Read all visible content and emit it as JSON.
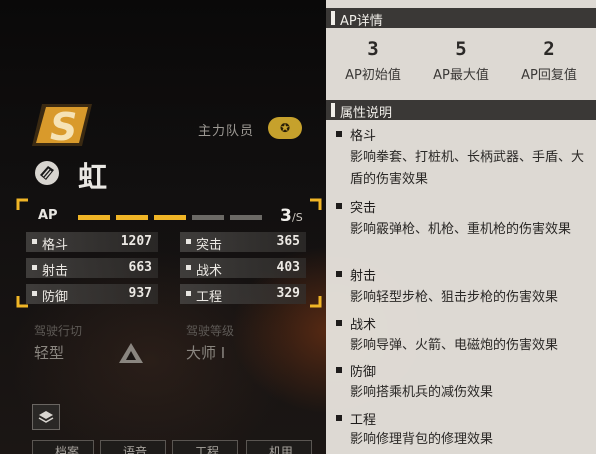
{
  "character": {
    "rank": "S",
    "member_label": "主力队员",
    "member_badge_icon": "squad-badge-icon",
    "name": "虹"
  },
  "ap": {
    "label": "AP",
    "current": "3",
    "unit": "/S",
    "filled": 3,
    "total": 5
  },
  "stats": [
    {
      "label": "格斗",
      "value": "1207"
    },
    {
      "label": "突击",
      "value": "365"
    },
    {
      "label": "射击",
      "value": "663"
    },
    {
      "label": "战术",
      "value": "403"
    },
    {
      "label": "防御",
      "value": "937"
    },
    {
      "label": "工程",
      "value": "329"
    }
  ],
  "lower": {
    "type_caption": "驾驶行切",
    "type_value": "轻型",
    "level_caption": "驾驶等级",
    "level_value": "大师 I"
  },
  "bottom_buttons": [
    "档案",
    "语音",
    "工程",
    "机甲"
  ],
  "panel": {
    "ap_section_title": "AP详情",
    "ap_details": [
      {
        "value": "3",
        "caption": "AP初始值"
      },
      {
        "value": "5",
        "caption": "AP最大值"
      },
      {
        "value": "2",
        "caption": "AP回复值"
      }
    ],
    "attr_section_title": "属性说明",
    "attributes": [
      {
        "name": "格斗",
        "desc": "影响拳套、打桩机、长柄武器、手盾、大盾的伤害效果"
      },
      {
        "name": "突击",
        "desc": "影响霰弹枪、机枪、重机枪的伤害效果"
      },
      {
        "name": "射击",
        "desc": "影响轻型步枪、狙击步枪的伤害效果"
      },
      {
        "name": "战术",
        "desc": "影响导弹、火箭、电磁炮的伤害效果"
      },
      {
        "name": "防御",
        "desc": "影响搭乘机兵的减伤效果"
      },
      {
        "name": "工程",
        "desc": "影响修理背包的修理效果"
      }
    ]
  },
  "colors": {
    "accent": "#f0b526",
    "panel_bg": "#e4e0da",
    "section_head": "#3a3836"
  }
}
